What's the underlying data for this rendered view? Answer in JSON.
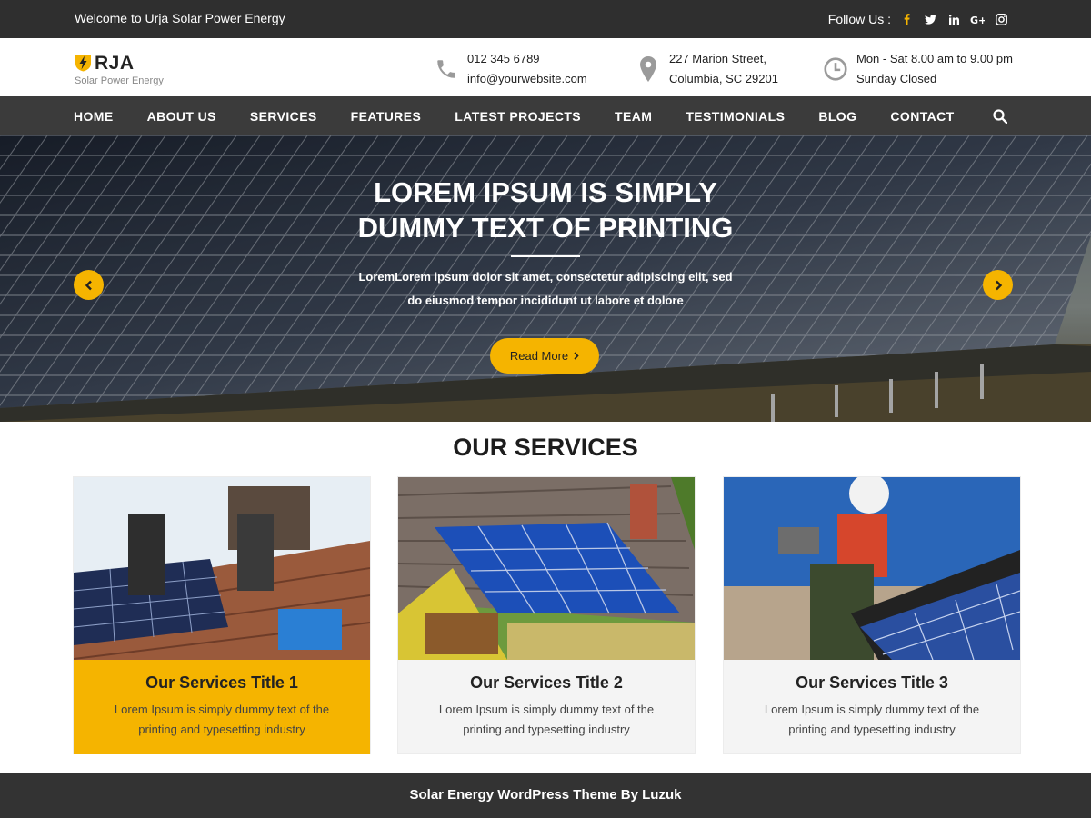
{
  "topbar": {
    "welcome": "Welcome to Urja Solar Power Energy",
    "follow_label": "Follow Us :",
    "social": [
      "facebook-icon",
      "twitter-icon",
      "linkedin-icon",
      "google-plus-icon",
      "instagram-icon"
    ]
  },
  "header": {
    "logo_name": "RJA",
    "logo_tagline": "Solar Power Energy",
    "phone": "012 345 6789",
    "email": "info@yourwebsite.com",
    "address_line1": "227 Marion Street,",
    "address_line2": "Columbia, SC 29201",
    "hours_line1": "Mon - Sat 8.00 am to 9.00 pm",
    "hours_line2": "Sunday Closed"
  },
  "nav": {
    "items": [
      "HOME",
      "ABOUT US",
      "SERVICES",
      "FEATURES",
      "LATEST PROJECTS",
      "TEAM",
      "TESTIMONIALS",
      "BLOG",
      "CONTACT"
    ]
  },
  "hero": {
    "title_line1": "LOREM IPSUM IS SIMPLY",
    "title_line2": "DUMMY TEXT OF PRINTING",
    "text_line1": "LoremLorem ipsum dolor sit amet, consectetur adipiscing elit, sed",
    "text_line2": "do eiusmod tempor incididunt ut labore et dolore",
    "button": "Read More"
  },
  "services": {
    "heading": "OUR SERVICES",
    "cards": [
      {
        "title": "Our Services Title 1",
        "desc_line1": "Lorem Ipsum is simply dummy text of the",
        "desc_line2": "printing and typesetting industry"
      },
      {
        "title": "Our Services Title 2",
        "desc_line1": "Lorem Ipsum is simply dummy text of the",
        "desc_line2": "printing and typesetting industry"
      },
      {
        "title": "Our Services Title 3",
        "desc_line1": "Lorem Ipsum is simply dummy text of the",
        "desc_line2": "printing and typesetting industry"
      }
    ]
  },
  "footer": {
    "credit": "Solar Energy WordPress Theme By Luzuk"
  },
  "colors": {
    "accent": "#f5b400",
    "topbar": "#2f2f2f",
    "nav": "#3b3b3b",
    "footer": "#333333"
  }
}
